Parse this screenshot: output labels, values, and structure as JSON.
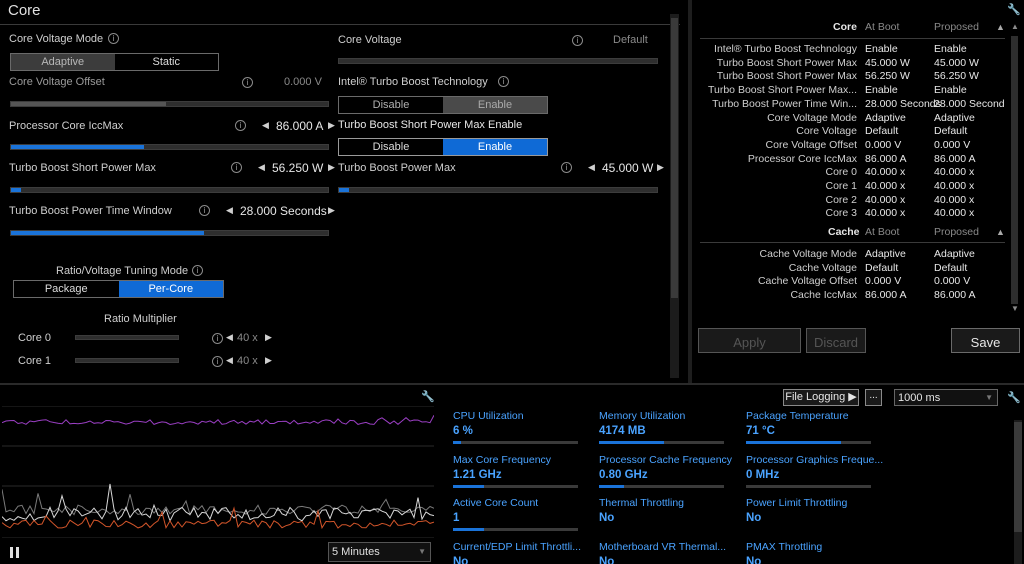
{
  "header": {
    "title": "Core"
  },
  "core_voltage_mode": {
    "label": "Core Voltage Mode",
    "options": [
      "Adaptive",
      "Static"
    ],
    "selected": "Adaptive"
  },
  "core_voltage": {
    "label": "Core Voltage",
    "value": "Default"
  },
  "core_voltage_offset": {
    "label": "Core Voltage Offset",
    "value": "0.000 V",
    "level": 0.49
  },
  "turbo_boost_tech": {
    "label": "Intel® Turbo Boost Technology",
    "options": [
      "Disable",
      "Enable"
    ],
    "selected": "Enable"
  },
  "iccmax": {
    "label": "Processor Core IccMax",
    "value": "86.000 A",
    "level": 0.42
  },
  "short_power_enable": {
    "label": "Turbo Boost Short Power Max Enable",
    "options": [
      "Disable",
      "Enable"
    ],
    "selected": "Enable"
  },
  "short_power_max": {
    "label": "Turbo Boost Short Power Max",
    "value": "56.250 W",
    "level": 0.03
  },
  "power_max": {
    "label": "Turbo Boost Power Max",
    "value": "45.000 W",
    "level": 0.03
  },
  "time_window": {
    "label": "Turbo Boost Power Time Window",
    "value": "28.000 Seconds",
    "level": 0.61
  },
  "tuning_mode": {
    "label": "Ratio/Voltage Tuning Mode",
    "options": [
      "Package",
      "Per-Core"
    ],
    "selected": "Per-Core"
  },
  "ratio": {
    "header": "Ratio Multiplier",
    "cores": [
      {
        "label": "Core 0",
        "value": "40 x"
      },
      {
        "label": "Core 1",
        "value": "40 x"
      }
    ]
  },
  "summary": {
    "core_header": "Core",
    "col_boot": "At Boot",
    "col_proposed": "Proposed",
    "core_rows": [
      {
        "name": "Intel® Turbo Boost Technology",
        "boot": "Enable",
        "proposed": "Enable"
      },
      {
        "name": "Turbo Boost Short Power Max",
        "boot": "45.000 W",
        "proposed": "45.000 W"
      },
      {
        "name": "Turbo Boost Short Power Max",
        "boot": "56.250 W",
        "proposed": "56.250 W"
      },
      {
        "name": "Turbo Boost Short Power Max...",
        "boot": "Enable",
        "proposed": "Enable"
      },
      {
        "name": "Turbo Boost Power Time Win...",
        "boot": "28.000 Seconds",
        "proposed": "28.000 Seconds"
      },
      {
        "name": "Core Voltage Mode",
        "boot": "Adaptive",
        "proposed": "Adaptive"
      },
      {
        "name": "Core Voltage",
        "boot": "Default",
        "proposed": "Default"
      },
      {
        "name": "Core Voltage Offset",
        "boot": "0.000 V",
        "proposed": "0.000 V"
      },
      {
        "name": "Processor Core IccMax",
        "boot": "86.000 A",
        "proposed": "86.000 A"
      },
      {
        "name": "Core 0",
        "boot": "40.000 x",
        "proposed": "40.000 x"
      },
      {
        "name": "Core 1",
        "boot": "40.000 x",
        "proposed": "40.000 x"
      },
      {
        "name": "Core 2",
        "boot": "40.000 x",
        "proposed": "40.000 x"
      },
      {
        "name": "Core 3",
        "boot": "40.000 x",
        "proposed": "40.000 x"
      }
    ],
    "cache_header": "Cache",
    "cache_boot": "At Boot",
    "cache_proposed": "Proposed",
    "cache_rows": [
      {
        "name": "Cache Voltage Mode",
        "boot": "Adaptive",
        "proposed": "Adaptive"
      },
      {
        "name": "Cache Voltage",
        "boot": "Default",
        "proposed": "Default"
      },
      {
        "name": "Cache Voltage Offset",
        "boot": "0.000 V",
        "proposed": "0.000 V"
      },
      {
        "name": "Cache IccMax",
        "boot": "86.000 A",
        "proposed": "86.000 A"
      }
    ]
  },
  "actions": {
    "apply": "Apply",
    "discard": "Discard",
    "save": "Save"
  },
  "monitor": {
    "file_logging": "File Logging ▶",
    "more": "...",
    "interval": "1000 ms",
    "timespan": "5 Minutes",
    "metrics": [
      {
        "title": "CPU Utilization",
        "value": "6 %",
        "level": 0.06
      },
      {
        "title": "Memory Utilization",
        "value": "4174  MB",
        "level": 0.52
      },
      {
        "title": "Package Temperature",
        "value": "71 °C",
        "level": 0.76
      },
      {
        "title": "Max Core Frequency",
        "value": "1.21 GHz",
        "level": 0.25
      },
      {
        "title": "Processor Cache Frequency",
        "value": "0.80 GHz",
        "level": 0.2
      },
      {
        "title": "Processor Graphics Freque...",
        "value": "0 MHz",
        "level": 0.0
      },
      {
        "title": "Active Core Count",
        "value": "1",
        "level": 0.25
      },
      {
        "title": "Thermal Throttling",
        "value": "No",
        "level": null
      },
      {
        "title": "Power Limit Throttling",
        "value": "No",
        "level": null
      },
      {
        "title": "Current/EDP Limit Throttli...",
        "value": "No",
        "level": null
      },
      {
        "title": "Motherboard VR Thermal...",
        "value": "No",
        "level": null
      },
      {
        "title": "PMAX Throttling",
        "value": "No",
        "level": null
      }
    ]
  },
  "colors": {
    "accent": "#0f6ad6",
    "monitor_text": "#4aa3ff",
    "line_purple": "#9b3fc4",
    "line_white": "#d8d8d8",
    "line_orange": "#d2552a",
    "line_gray": "#7a7a7a"
  }
}
